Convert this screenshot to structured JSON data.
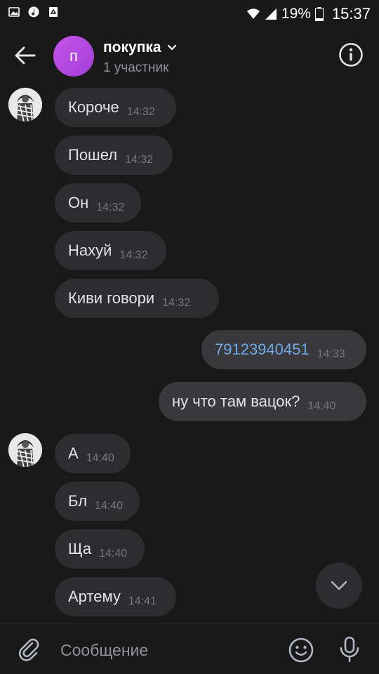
{
  "status_bar": {
    "battery_percent": "19%",
    "time": "15:37",
    "icons": [
      "image-icon",
      "music-icon",
      "recycle-icon",
      "wifi-icon",
      "signal-icon",
      "battery-icon"
    ]
  },
  "header": {
    "avatar_letter": "п",
    "title": "покупка",
    "subtitle": "1 участник",
    "avatar_color": "#b84ae0"
  },
  "messages": [
    {
      "direction": "in",
      "text": "Короче",
      "time": "14:32"
    },
    {
      "direction": "in",
      "text": "Пошел",
      "time": "14:32"
    },
    {
      "direction": "in",
      "text": "Он",
      "time": "14:32"
    },
    {
      "direction": "in",
      "text": "Нахуй",
      "time": "14:32"
    },
    {
      "direction": "in",
      "text": "Киви говори",
      "time": "14:32"
    },
    {
      "direction": "out",
      "text": "79123940451",
      "time": "14:33",
      "is_link": true
    },
    {
      "direction": "out",
      "text": "ну что там вацок?",
      "time": "14:40"
    },
    {
      "direction": "in",
      "text": "А",
      "time": "14:40"
    },
    {
      "direction": "in",
      "text": "Бл",
      "time": "14:40"
    },
    {
      "direction": "in",
      "text": "Ща",
      "time": "14:40"
    },
    {
      "direction": "in",
      "text": "Артему",
      "time": "14:41"
    }
  ],
  "composer": {
    "placeholder": "Сообщение"
  },
  "colors": {
    "background": "#19191a",
    "bubble_in": "#2c2d2e",
    "bubble_out": "#39393b",
    "link": "#71aaeb"
  }
}
